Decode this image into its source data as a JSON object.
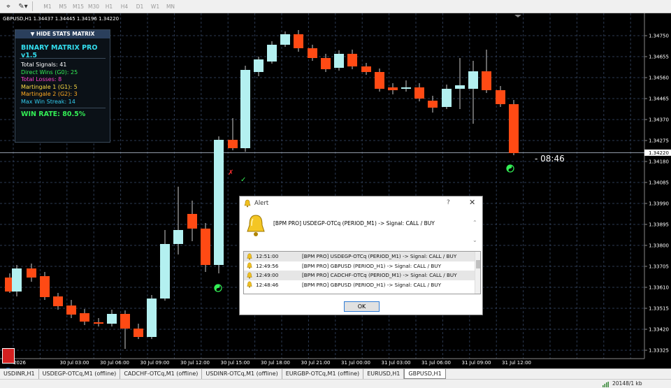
{
  "toolbar": {
    "timeframes": [
      "M1",
      "M5",
      "M15",
      "M30",
      "H1",
      "H4",
      "D1",
      "W1",
      "MN"
    ]
  },
  "chart": {
    "symbol_info": "GBPUSD,H1  1.34437 1.34445 1.34196 1.34220",
    "price_labels": [
      "1.34750",
      "1.34655",
      "1.34560",
      "1.34465",
      "1.34370",
      "1.34275",
      "1.34180",
      "1.34085",
      "1.33990",
      "1.33895",
      "1.33800",
      "1.33705",
      "1.33610",
      "1.33515",
      "1.33420",
      "1.33325"
    ],
    "current_price": "1.34220",
    "time_labels": [
      "2026",
      "30 Jul 03:00",
      "30 Jul 06:00",
      "30 Jul 09:00",
      "30 Jul 12:00",
      "30 Jul 15:00",
      "30 Jul 18:00",
      "30 Jul 21:00",
      "31 Jul 00:00",
      "31 Jul 03:00",
      "31 Jul 06:00",
      "31 Jul 09:00",
      "31 Jul 12:00"
    ],
    "countdown": "- 08:46",
    "colors": {
      "bull": "#b3f0f0",
      "bear": "#ff4a14",
      "grid": "#2c3a52",
      "wick": "#cccccc"
    }
  },
  "stats": {
    "toggle_label": "▼ HIDE STATS MATRIX",
    "title": "BINARY MATRIX PRO v1.5",
    "lines": [
      {
        "text": "Total Signals: 41",
        "color": "#ffffff"
      },
      {
        "text": "Direct Wins (G0): 25",
        "color": "#33ee55"
      },
      {
        "text": "Total Losses: 8",
        "color": "#ff44cc"
      },
      {
        "text": "Martingale 1 (G1): 5",
        "color": "#ffdd44"
      },
      {
        "text": "Martingale 2 (G2): 3",
        "color": "#ffaa22"
      },
      {
        "text": "Max Win Streak: 14",
        "color": "#33ccee"
      }
    ],
    "win_rate": "WIN RATE: 80.5%"
  },
  "alert": {
    "title": "Alert",
    "help": "?",
    "close": "✕",
    "message": "[BPM PRO] USDEGP-OTCq (PERIOD_M1) -> Signal: CALL / BUY",
    "rows": [
      {
        "time": "12:51:00",
        "msg": "[BPM PRO] USDEGP-OTCq (PERIOD_M1) -> Signal: CALL / BUY"
      },
      {
        "time": "12:49:56",
        "msg": "[BPM PRO] GBPUSD (PERIOD_H1) -> Signal: CALL / BUY"
      },
      {
        "time": "12:49:00",
        "msg": "[BPM PRO] CADCHF-OTCq (PERIOD_M1) -> Signal: CALL / BUY"
      },
      {
        "time": "12:48:46",
        "msg": "[BPM PRO] GBPUSD (PERIOD_H1) -> Signal: CALL / BUY"
      }
    ],
    "ok_label": "OK"
  },
  "tabs": [
    {
      "label": "USDINR,H1",
      "active": false
    },
    {
      "label": "USDEGP-OTCq,M1 (offline)",
      "active": false
    },
    {
      "label": "CADCHF-OTCq,M1 (offline)",
      "active": false
    },
    {
      "label": "USDINR-OTCq,M1 (offline)",
      "active": false
    },
    {
      "label": "EURGBP-OTCq,M1 (offline)",
      "active": false
    },
    {
      "label": "EURUSD,H1",
      "active": false
    },
    {
      "label": "GBPUSD,H1",
      "active": true
    }
  ],
  "status": {
    "text": "20148/1 kb"
  }
}
